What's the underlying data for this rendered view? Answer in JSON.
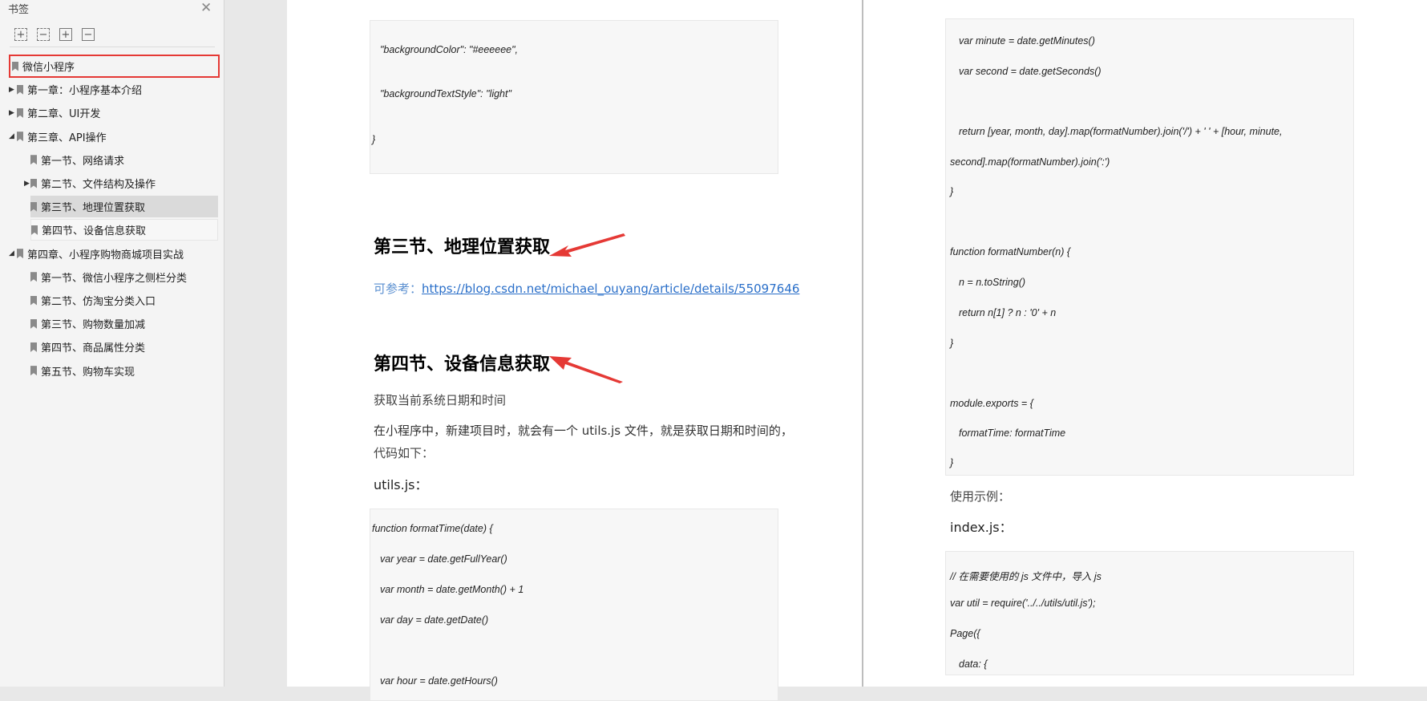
{
  "sidebar": {
    "title": "书签",
    "close_icon": "close-icon",
    "toolbar": [
      "expand-all-icon",
      "collapse-all-icon",
      "add-bookmark-icon",
      "remove-bookmark-icon"
    ],
    "items": [
      {
        "label": "微信小程序",
        "level": 0,
        "expander": "none",
        "state": "highlighted-red"
      },
      {
        "label": "第一章：小程序基本介绍",
        "level": 0,
        "expander": "collapsed"
      },
      {
        "label": "第二章、UI开发",
        "level": 0,
        "expander": "collapsed"
      },
      {
        "label": "第三章、API操作",
        "level": 0,
        "expander": "expanded"
      },
      {
        "label": "第一节、网络请求",
        "level": 1,
        "expander": "none"
      },
      {
        "label": "第二节、文件结构及操作",
        "level": 1,
        "expander": "collapsed"
      },
      {
        "label": "第三节、地理位置获取",
        "level": 1,
        "expander": "none",
        "state": "selected"
      },
      {
        "label": "第四节、设备信息获取",
        "level": 1,
        "expander": "none",
        "state": "hover"
      },
      {
        "label": "第四章、小程序购物商城项目实战",
        "level": 0,
        "expander": "expanded"
      },
      {
        "label": "第一节、微信小程序之侧栏分类",
        "level": 1,
        "expander": "none"
      },
      {
        "label": "第二节、仿淘宝分类入口",
        "level": 1,
        "expander": "none"
      },
      {
        "label": "第三节、购物数量加减",
        "level": 1,
        "expander": "none"
      },
      {
        "label": "第四节、商品属性分类",
        "level": 1,
        "expander": "none"
      },
      {
        "label": "第五节、购物车实现",
        "level": 1,
        "expander": "none"
      }
    ]
  },
  "page1": {
    "code1": [
      "\"backgroundColor\": \"#eeeeee\",",
      "\"backgroundTextStyle\": \"light\"",
      "}"
    ],
    "heading1": "第三节、地理位置获取",
    "ref_label": "可参考：",
    "ref_link": "https://blog.csdn.net/michael_ouyang/article/details/55097646",
    "heading2": "第四节、设备信息获取",
    "p1": "获取当前系统日期和时间",
    "p2a": "在小程序中，新建项目时，就会有一个 utils.js 文件，就是获取日期和时间的，",
    "p2b": "代码如下：",
    "file1": "utils.js：",
    "code2": [
      "function formatTime(date) {",
      "var year = date.getFullYear()",
      "var month = date.getMonth() + 1",
      "var day = date.getDate()",
      "var hour = date.getHours()"
    ]
  },
  "page2": {
    "code1": [
      "var minute = date.getMinutes()",
      "var second = date.getSeconds()",
      "return [year, month, day].map(formatNumber).join('/') + ' ' + [hour, minute,",
      "second].map(formatNumber).join(':')",
      "}",
      "function formatNumber(n) {",
      "n = n.toString()",
      "return n[1] ? n : '0' + n",
      "}",
      "module.exports = {",
      "formatTime: formatTime",
      "}"
    ],
    "usage": "使用示例：",
    "file2": "index.js：",
    "code2": [
      "// 在需要使用的 js 文件中，导入 js",
      "var util = require('../../utils/util.js');",
      "Page({",
      "data: {"
    ]
  },
  "colors": {
    "annotation": "#e53935",
    "link": "#2a6fc9"
  }
}
